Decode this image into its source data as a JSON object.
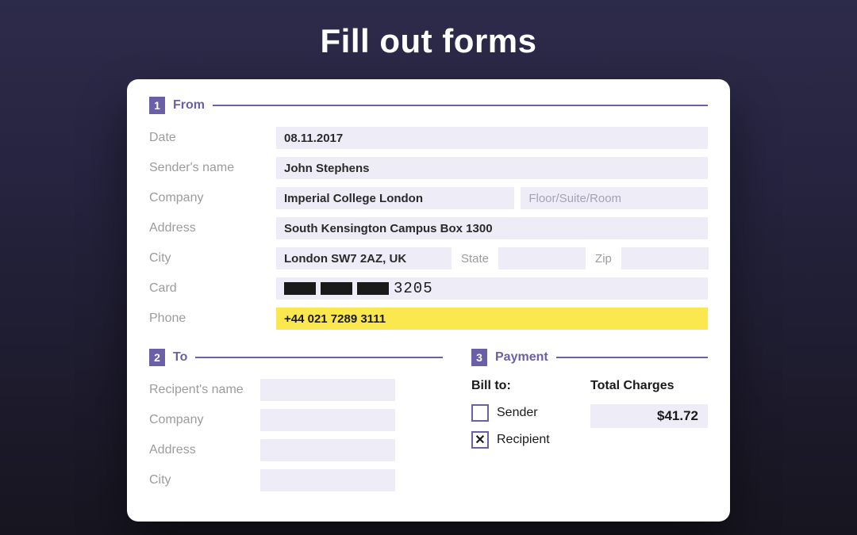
{
  "heading": "Fill out forms",
  "from": {
    "num": "1",
    "title": "From",
    "labels": {
      "date": "Date",
      "sender_name": "Sender's name",
      "company": "Company",
      "address": "Address",
      "city": "City",
      "state": "State",
      "zip": "Zip",
      "card": "Card",
      "phone": "Phone"
    },
    "values": {
      "date": "08.11.2017",
      "sender_name": "John Stephens",
      "company": "Imperial College London",
      "floor_placeholder": "Floor/Suite/Room",
      "address": "South Kensington Campus Box 1300",
      "city": "London SW7 2AZ, UK",
      "state": "",
      "zip": "",
      "card_last": "3205",
      "phone": "+44 021 7289 3111"
    }
  },
  "to": {
    "num": "2",
    "title": "To",
    "labels": {
      "recipient_name": "Recipent's name",
      "company": "Company",
      "address": "Address",
      "city": "City"
    },
    "values": {
      "recipient_name": "",
      "company": "",
      "address": "",
      "city": ""
    }
  },
  "payment": {
    "num": "3",
    "title": "Payment",
    "bill_to_label": "Bill to:",
    "sender_label": "Sender",
    "recipient_label": "Recipient",
    "total_label": "Total  Charges",
    "total_value": "$41.72",
    "sender_checked": false,
    "recipient_checked": true
  }
}
